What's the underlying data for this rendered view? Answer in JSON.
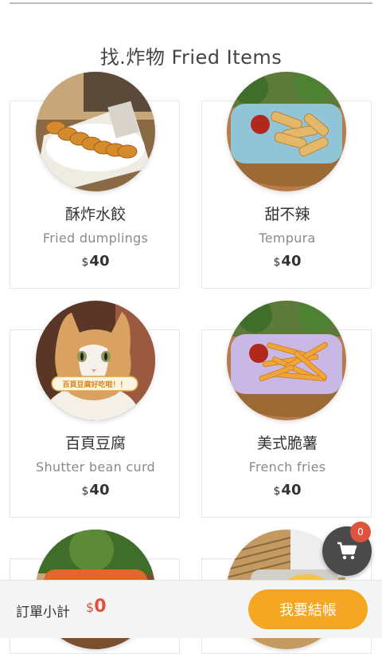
{
  "section": {
    "title": "找.炸物 Fried Items"
  },
  "currency_symbol": "$",
  "items": [
    {
      "name_zh": "酥炸水餃",
      "name_en": "Fried dumplings",
      "price": "40"
    },
    {
      "name_zh": "甜不辣",
      "name_en": "Tempura",
      "price": "40"
    },
    {
      "name_zh": "百頁豆腐",
      "name_en": "Shutter bean curd",
      "price": "40",
      "image_caption": "百頁豆腐好吃啦！！"
    },
    {
      "name_zh": "美式脆薯",
      "name_en": "French fries",
      "price": "40"
    }
  ],
  "cart": {
    "count": "0",
    "icon": "shopping-cart-icon"
  },
  "order": {
    "subtotal_label": "訂單小計",
    "subtotal_value": "0",
    "checkout_label": "我要結帳"
  },
  "colors": {
    "accent": "#f5a623",
    "price_red": "#e0533d",
    "fab": "#4a4a4a"
  }
}
